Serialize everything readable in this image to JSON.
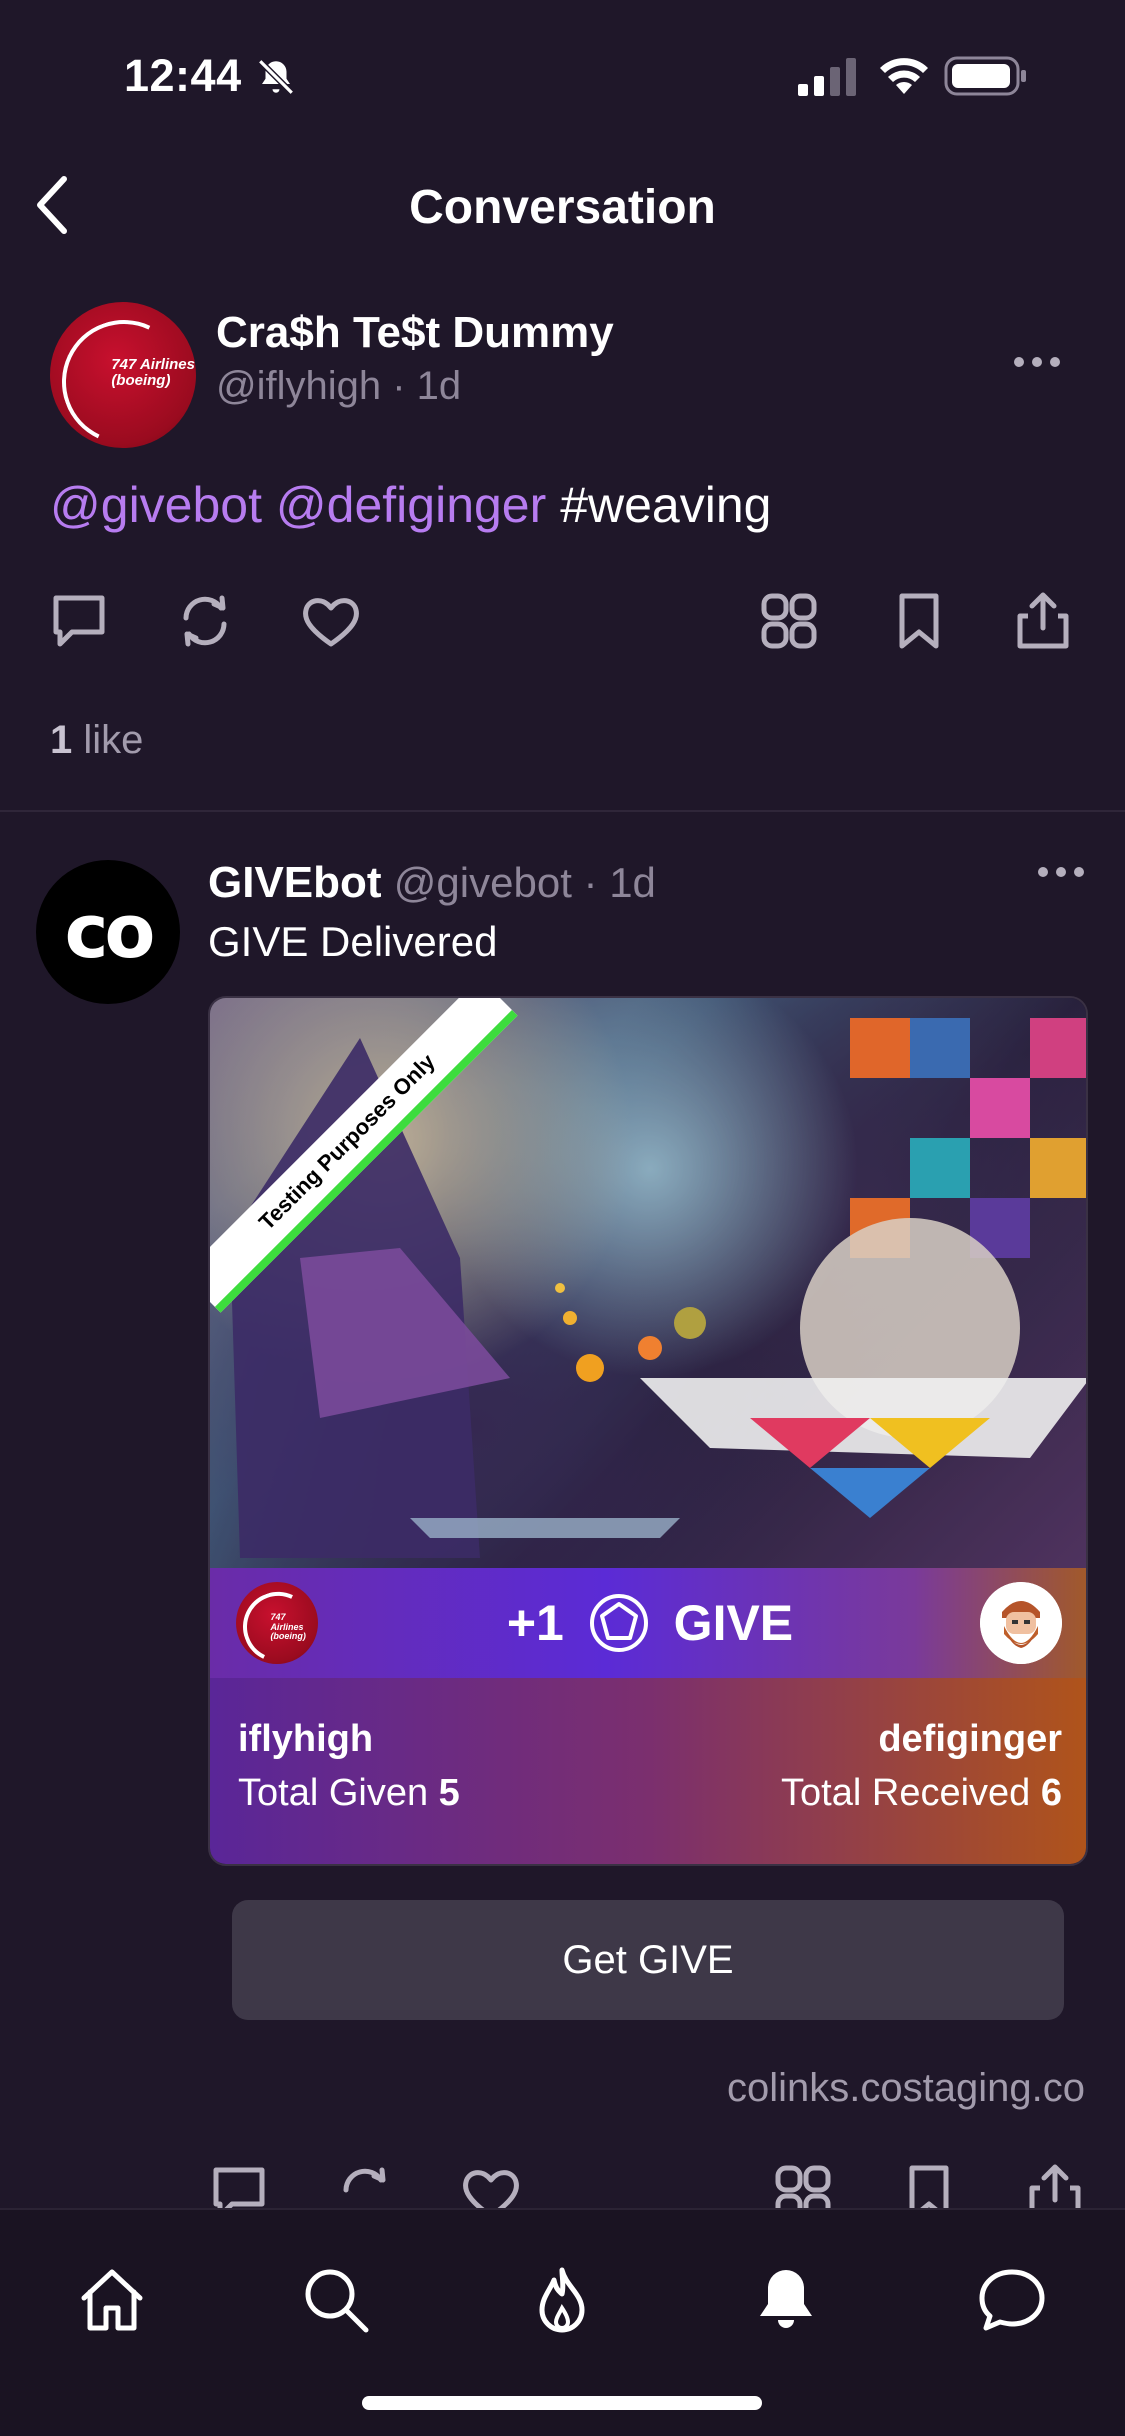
{
  "status_bar": {
    "time": "12:44"
  },
  "nav": {
    "title": "Conversation"
  },
  "post1": {
    "author": "Cra$h Te$t Dummy",
    "handle_time": "@iflyhigh · 1d",
    "avatar_text_1": "747 Airlines",
    "avatar_text_2": "(boeing)",
    "mention_1": "@givebot",
    "mention_2": "@defiginger",
    "hashtag": "#weaving",
    "likes_count": "1",
    "likes_label": " like"
  },
  "post2": {
    "author": "GIVEbot",
    "handle_time": "@givebot · 1d",
    "avatar_text": "co",
    "text": "GIVE Delivered",
    "card": {
      "ribbon": "Testing Purposes Only",
      "give_prefix": "+1",
      "give_label": "GIVE",
      "giver": "iflyhigh",
      "giver_stat_label": "Total Given",
      "giver_stat_value": "5",
      "receiver": "defiginger",
      "receiver_stat_label": "Total Received",
      "receiver_stat_value": "6"
    },
    "button": "Get GIVE",
    "domain": "colinks.costaging.co"
  },
  "colors": {
    "background": "#1f1729",
    "mention": "#b77cf0",
    "muted": "#8e8699"
  }
}
